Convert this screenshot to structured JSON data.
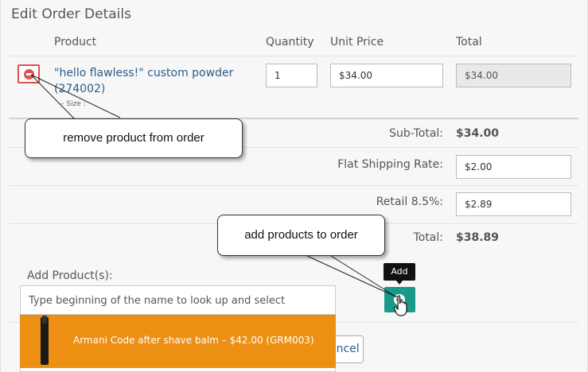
{
  "header": {
    "title": "Edit Order Details"
  },
  "columns": {
    "product": "Product",
    "quantity": "Quantity",
    "unit_price": "Unit Price",
    "total": "Total"
  },
  "line_item": {
    "name": "\"hello flawless!\" custom powder (274002)",
    "attribute": "– Size :",
    "quantity": "1",
    "unit_price": "$34.00",
    "total": "$34.00"
  },
  "totals": {
    "subtotal_label": "Sub-Total:",
    "subtotal_value": "$34.00",
    "shipping_label": "Flat Shipping Rate:",
    "shipping_value": "$2.00",
    "tax_label": "Retail 8.5%:",
    "tax_value": "$2.89",
    "total_label": "Total:",
    "total_value": "$38.89"
  },
  "add_products": {
    "label": "Add Product(s):",
    "placeholder": "Type beginning of the name to look up and select",
    "suggestion": "Armani Code after shave balm – $42.00 (GRM003)",
    "add_tooltip": "Add"
  },
  "buttons": {
    "cancel": "ancel"
  },
  "callouts": {
    "remove": "remove product from order",
    "add": "add products to order"
  },
  "colors": {
    "accent_orange": "#ed8f12",
    "add_button": "#1a9a8a",
    "remove_red": "#d9534f",
    "link_blue": "#2a5d8a"
  }
}
